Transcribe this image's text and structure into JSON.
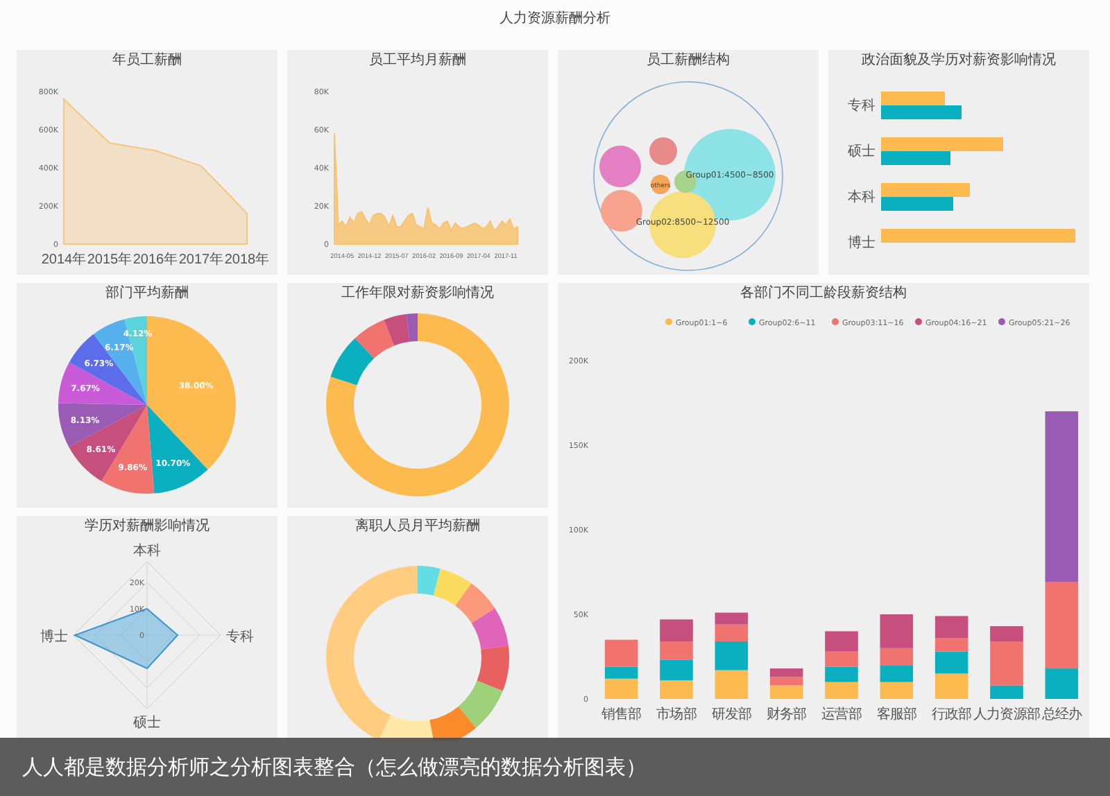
{
  "title": "人力资源薪酬分析",
  "panels": [
    {
      "kind": "area",
      "title": "年员工薪酬",
      "chart_data": {
        "type": "area",
        "categories": [
          "2014年",
          "2015年",
          "2016年",
          "2017年",
          "2018年"
        ],
        "series": [
          {
            "color": "#f5c77e",
            "values": [
              760000,
              530000,
              490000,
              410000,
              160000
            ]
          }
        ],
        "ylim": [
          0,
          800000
        ],
        "yticks": [
          {
            "value": 0,
            "label": "0"
          },
          {
            "value": 200000,
            "label": "200K"
          },
          {
            "value": 400000,
            "label": "400K"
          },
          {
            "value": 600000,
            "label": "600K"
          },
          {
            "value": 800000,
            "label": "800K"
          }
        ]
      }
    },
    {
      "kind": "area",
      "title": "员工平均月薪酬",
      "chart_data": {
        "type": "area",
        "categories": [
          null,
          null,
          "2014-05",
          null,
          null,
          null,
          null,
          null,
          null,
          "2014-12",
          null,
          null,
          null,
          null,
          null,
          null,
          "2015-07",
          null,
          null,
          null,
          null,
          null,
          null,
          "2016-02",
          null,
          null,
          null,
          null,
          null,
          null,
          "2016-09",
          null,
          null,
          null,
          null,
          null,
          null,
          "2017-04",
          null,
          null,
          null,
          null,
          null,
          null,
          "2017-11",
          null,
          null,
          null
        ],
        "series": [
          {
            "color": "#f7c370",
            "values": [
              58000,
              10000,
              12000,
              9000,
              14000,
              11000,
              16000,
              17000,
              13000,
              10000,
              15000,
              16000,
              16000,
              14000,
              9000,
              15000,
              9000,
              9000,
              12000,
              15000,
              16000,
              10000,
              9000,
              8000,
              19000,
              11000,
              10000,
              8000,
              11000,
              12000,
              7000,
              11000,
              9000,
              8000,
              9000,
              10000,
              11000,
              10000,
              8000,
              9000,
              12000,
              7000,
              9000,
              12000,
              10000,
              13000,
              8000,
              9000
            ]
          }
        ],
        "ylim": [
          0,
          80000
        ],
        "yticks": [
          {
            "value": 0,
            "label": "0"
          },
          {
            "value": 20000,
            "label": "20K"
          },
          {
            "value": 40000,
            "label": "40K"
          },
          {
            "value": 60000,
            "label": "60K"
          },
          {
            "value": 80000,
            "label": "80K"
          }
        ]
      }
    },
    {
      "kind": "bubble",
      "title": "员工薪酬结构",
      "bubbles": [
        {
          "label": "Group01:4500~8500",
          "color": "#8ee3e6"
        },
        {
          "label": "Group02:8500~12500",
          "color": "#f7df7e"
        },
        {
          "label": "others",
          "color": "#f5a65b"
        },
        {
          "color": "#e37fc2"
        },
        {
          "color": "#e88a8a"
        },
        {
          "color": "#a6d38c"
        },
        {
          "color": "#f7a38e"
        }
      ]
    },
    {
      "kind": "hbar",
      "title": "政治面貌及学历对薪资影响情况",
      "categories": [
        "专科",
        "硕士",
        "本科",
        "博士"
      ]
    },
    {
      "kind": "pie",
      "title": "部门平均薪酬",
      "chart_data": {
        "type": "pie",
        "values": [
          38.0,
          10.7,
          9.86,
          8.61,
          8.13,
          7.67,
          6.73,
          6.17,
          4.12
        ],
        "value_labels": [
          "38.00%",
          "10.70%",
          "9.86%",
          "8.61%",
          "8.13%",
          "7.67%",
          "6.73%",
          "6.17%",
          "4.12%"
        ]
      }
    },
    {
      "kind": "donut",
      "title": "工作年限对薪资影响情况"
    },
    {
      "kind": "stacked",
      "title": "各部门不同工龄段薪资结构",
      "chart_data": {
        "type": "bar",
        "stacked": true,
        "legend": true,
        "categories": [
          "销售部",
          "市场部",
          "研发部",
          "财务部",
          "运营部",
          "客服部",
          "行政部",
          "人力资源部",
          "总经办"
        ],
        "series": [
          {
            "name": "Group01:1~6",
            "color": "#fdbb4f",
            "values": [
              12000,
              11000,
              17000,
              8000,
              10000,
              10000,
              15000,
              0,
              0
            ]
          },
          {
            "name": "Group02:6~11",
            "color": "#0ab0c0",
            "values": [
              7000,
              12000,
              17000,
              0,
              9000,
              10000,
              13000,
              8000,
              18000
            ]
          },
          {
            "name": "Group03:11~16",
            "color": "#f07370",
            "values": [
              16000,
              11000,
              10000,
              5000,
              9000,
              10000,
              8000,
              26000,
              51000
            ]
          },
          {
            "name": "Group04:16~21",
            "color": "#c64f7e",
            "values": [
              0,
              13000,
              7000,
              5000,
              12000,
              20000,
              13000,
              9000,
              0
            ]
          },
          {
            "name": "Group05:21~26",
            "color": "#9a5bb5",
            "values": [
              0,
              0,
              0,
              0,
              0,
              0,
              0,
              0,
              101000
            ]
          }
        ],
        "ylim": [
          0,
          200000
        ],
        "yticks": [
          {
            "value": 0,
            "label": "0"
          },
          {
            "value": 50000,
            "label": "50K"
          },
          {
            "value": 100000,
            "label": "100K"
          },
          {
            "value": 150000,
            "label": "150K"
          },
          {
            "value": 200000,
            "label": "200K"
          }
        ]
      }
    },
    {
      "kind": "radar",
      "title": "学历对薪酬影响情况",
      "axes": [
        "本科",
        "专科",
        "硕士",
        "博士"
      ],
      "ticks": [
        "20K",
        "10K",
        "0"
      ]
    },
    {
      "kind": "donut",
      "title": "离职人员月平均薪酬"
    }
  ],
  "caption": "人人都是数据分析师之分析图表整合（怎么做漂亮的数据分析图表）"
}
